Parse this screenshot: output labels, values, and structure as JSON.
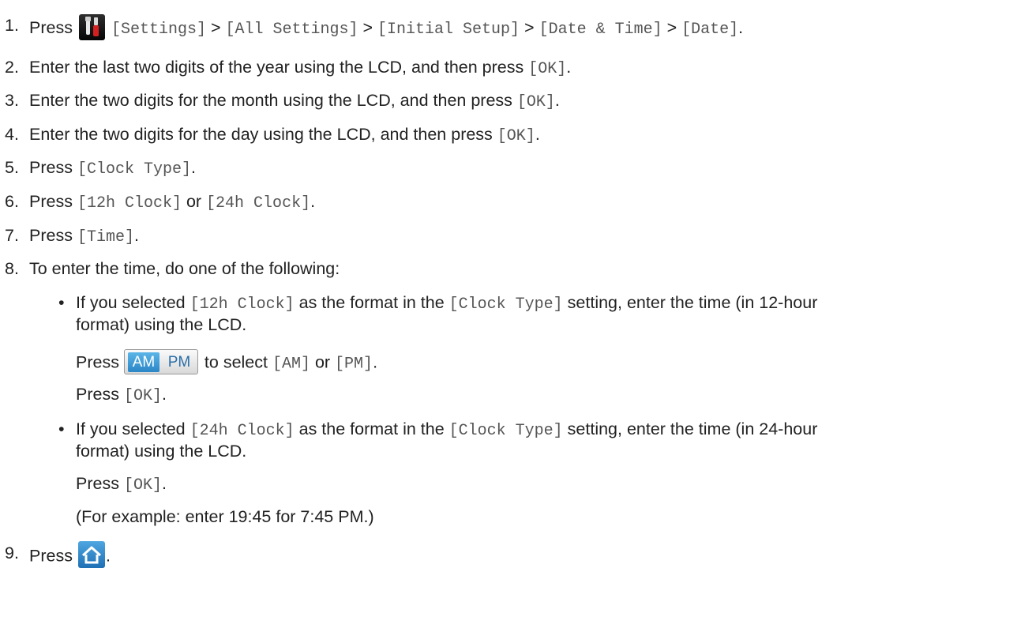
{
  "steps": [
    {
      "n": "1.",
      "press": "Press",
      "path": "[Settings] > [All Settings] > [Initial Setup] > [Date & Time] > [Date].",
      "p1": "[Settings]",
      "s1": " > ",
      "p2": "[All Settings]",
      "s2": " > ",
      "p3": "[Initial Setup]",
      "s3": " > ",
      "p4": "[Date & Time]",
      "s4": " > ",
      "p5": "[Date]",
      "end": "."
    },
    {
      "n": "2.",
      "text": "Enter the last two digits of the year using the LCD, and then press ",
      "code": "[OK]",
      "end": "."
    },
    {
      "n": "3.",
      "text": "Enter the two digits for the month using the LCD, and then press ",
      "code": "[OK]",
      "end": "."
    },
    {
      "n": "4.",
      "text": "Enter the two digits for the day using the LCD, and then press ",
      "code": "[OK]",
      "end": "."
    },
    {
      "n": "5.",
      "text": "Press ",
      "code": "[Clock Type]",
      "end": "."
    },
    {
      "n": "6.",
      "text": "Press ",
      "code": "[12h Clock]",
      "mid": " or ",
      "code2": "[24h Clock]",
      "end": "."
    },
    {
      "n": "7.",
      "text": "Press ",
      "code": "[Time]",
      "end": "."
    },
    {
      "n": "8.",
      "text": "To enter the time, do one of the following:"
    },
    {
      "n": "9.",
      "text": "Press",
      "end": "."
    }
  ],
  "bullets": [
    {
      "t1": "If you selected ",
      "c1": "[12h Clock]",
      "t2": " as the format in the ",
      "c2": "[Clock Type]",
      "t3": " setting, enter the time (in 12-hour",
      "l2": "format) using the LCD.",
      "p_press": "Press ",
      "p_to": " to select ",
      "p_am": "[AM]",
      "p_or": " or ",
      "p_pm": "[PM]",
      "p_end": ".",
      "ok_press": "Press ",
      "ok": "[OK]",
      "ok_end": "."
    },
    {
      "t1": "If you selected ",
      "c1": "[24h Clock]",
      "t2": " as the format in the ",
      "c2": "[Clock Type]",
      "t3": " setting, enter the time (in 24-hour",
      "l2": "format) using the LCD.",
      "ok_press": "Press ",
      "ok": "[OK]",
      "ok_end": ".",
      "example": "(For example: enter 19:45 for 7:45 PM.)"
    }
  ],
  "bullet_char": "•",
  "buttons": {
    "settings_icon": "settings-wrench-screwdriver-icon",
    "ampm": {
      "am": "AM",
      "pm": "PM"
    },
    "home_icon": "home-icon"
  },
  "colors": {
    "am_active": "#2b86c6",
    "home_blue": "#1f70b5",
    "settings_dark": "#050505"
  }
}
